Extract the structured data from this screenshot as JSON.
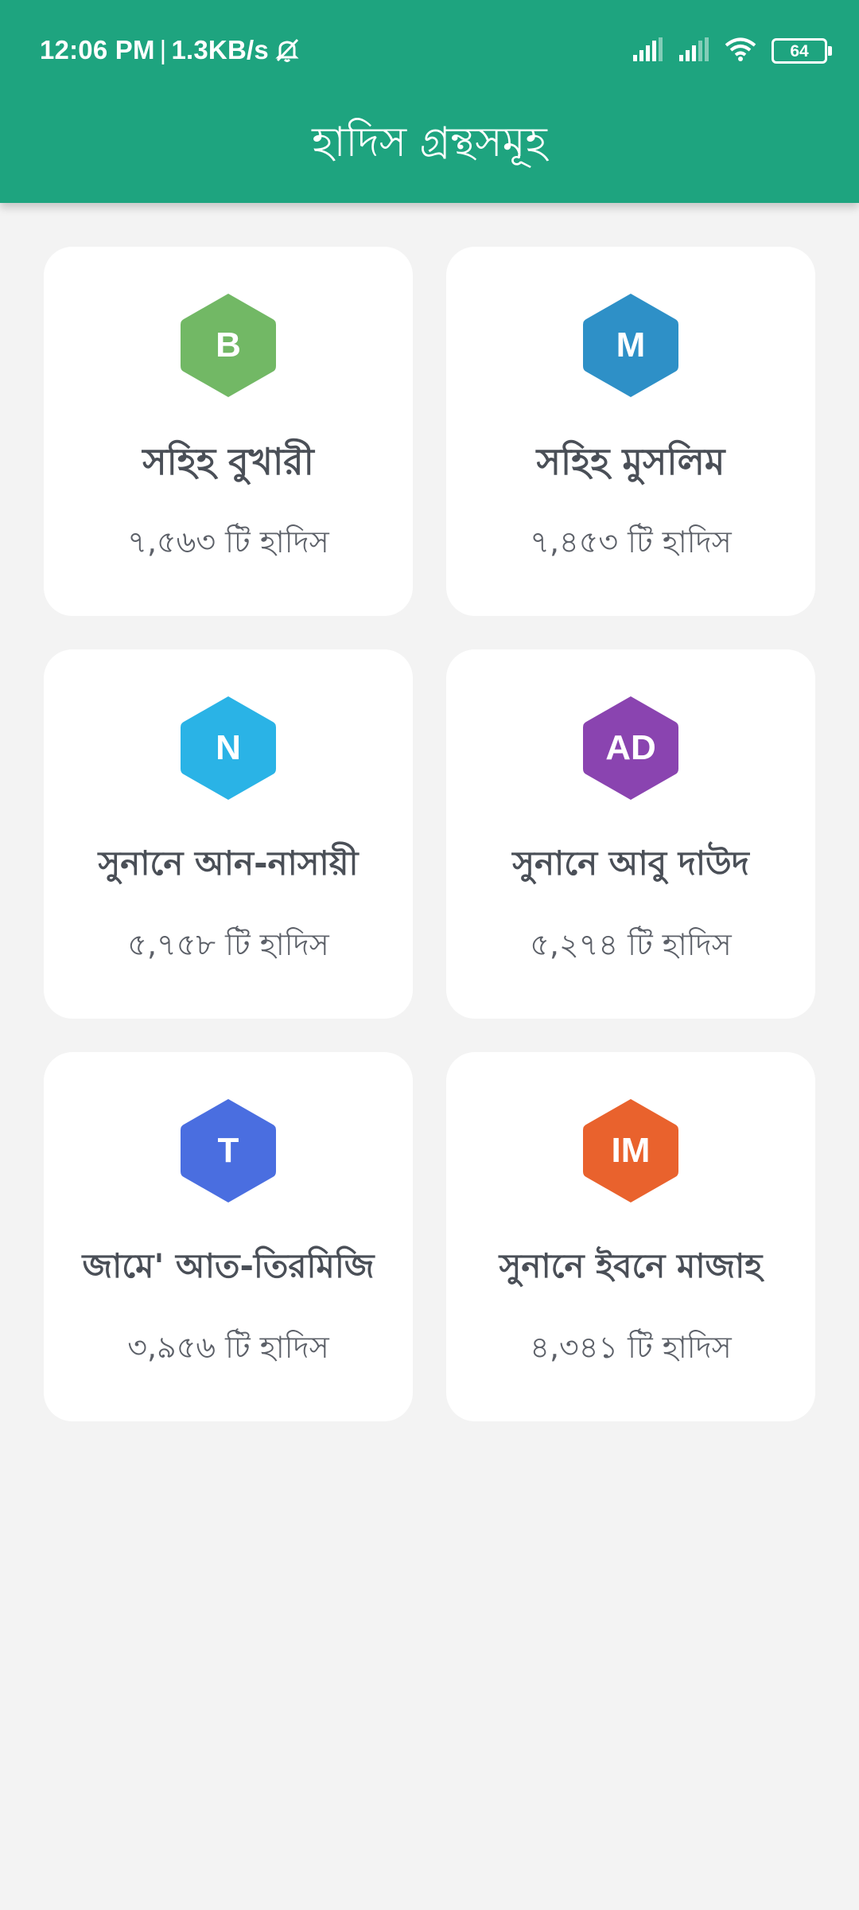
{
  "status_bar": {
    "time": "12:06 PM",
    "separator": "|",
    "speed": "1.3KB/s",
    "battery": "64",
    "icons": [
      "mute-icon",
      "signal-icon",
      "signal-icon",
      "wifi-icon",
      "battery-icon"
    ]
  },
  "header": {
    "title": "হাদিস গ্রন্থসমূহ",
    "color": "#1ea47f"
  },
  "books": [
    {
      "badge": "B",
      "name": "সহিহ বুখারী",
      "count": "৭,৫৬৩ টি হাদিস",
      "color": "#72b865"
    },
    {
      "badge": "M",
      "name": "সহিহ মুসলিম",
      "count": "৭,৪৫৩ টি হাদিস",
      "color": "#2e90c7"
    },
    {
      "badge": "N",
      "name": "সুনানে আন-নাসায়ী",
      "count": "৫,৭৫৮ টি হাদিস",
      "color": "#2ab3e6"
    },
    {
      "badge": "AD",
      "name": "সুনানে আবু দাউদ",
      "count": "৫,২৭৪ টি হাদিস",
      "color": "#8a44b0"
    },
    {
      "badge": "T",
      "name": "জামে' আত-তিরমিজি",
      "count": "৩,৯৫৬ টি হাদিস",
      "color": "#4a6ee0"
    },
    {
      "badge": "IM",
      "name": "সুনানে ইবনে মাজাহ",
      "count": "৪,৩৪১ টি হাদিস",
      "color": "#e9622d"
    }
  ]
}
